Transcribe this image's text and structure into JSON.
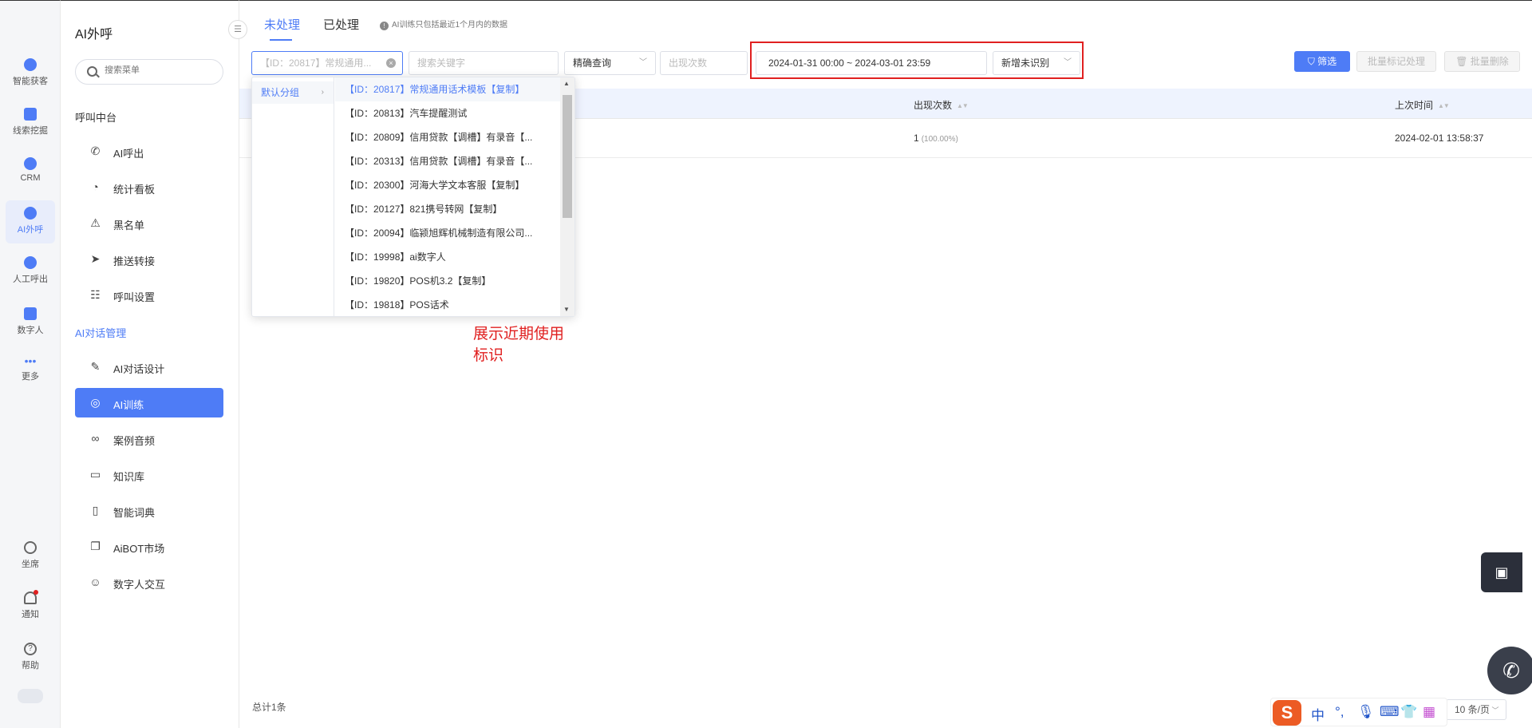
{
  "rail": {
    "items": [
      {
        "label": "智能获客",
        "icon": "smart-acquisition-icon"
      },
      {
        "label": "线索挖掘",
        "icon": "lead-mining-icon"
      },
      {
        "label": "CRM",
        "icon": "crm-icon"
      },
      {
        "label": "AI外呼",
        "icon": "ai-outbound-icon"
      },
      {
        "label": "人工呼出",
        "icon": "manual-call-icon"
      },
      {
        "label": "数字人",
        "icon": "digital-human-icon"
      },
      {
        "label": "更多",
        "icon": "more-icon"
      }
    ],
    "bottom": [
      {
        "label": "坐席",
        "icon": "headset-icon"
      },
      {
        "label": "通知",
        "icon": "bell-icon"
      },
      {
        "label": "帮助",
        "icon": "help-icon"
      }
    ]
  },
  "menu": {
    "title": "AI外呼",
    "search_placeholder": "搜索菜单",
    "group1": "呼叫中台",
    "group1_items": [
      "AI呼出",
      "统计看板",
      "黑名单",
      "推送转接",
      "呼叫设置"
    ],
    "group2": "AI对话管理",
    "group2_items": [
      "AI对话设计",
      "AI训练",
      "案例音频",
      "知识库",
      "智能词典",
      "AiBOT市场",
      "数字人交互"
    ]
  },
  "tabs": {
    "unprocessed": "未处理",
    "processed": "已处理",
    "notice": "AI训练只包括最近1个月内的数据"
  },
  "filters": {
    "script_select_value": "【ID：20817】常规通用...",
    "keyword_placeholder": "搜索关键字",
    "match_mode": "精确查询",
    "count_placeholder": "出现次数",
    "date_range": "2024-01-31 00:00 ~ 2024-03-01 23:59",
    "type_select": "新增未识别",
    "filter_button": "筛选",
    "batch_mark_button": "批量标记处理",
    "batch_delete_button": "批量删除"
  },
  "table": {
    "headers": [
      "出现次数",
      "上次时间"
    ],
    "rows": [
      {
        "count": "1",
        "percent": "(100.00%)",
        "last_time": "2024-02-01 13:58:37"
      }
    ],
    "total": "总计1条",
    "page_size": "10 条/页"
  },
  "cascader": {
    "group": "默认分组",
    "options": [
      "【ID：20817】常规通用话术模板【复制】",
      "【ID：20813】汽车提醒测试",
      "【ID：20809】信用贷款【调槽】有录音【...",
      "【ID：20313】信用贷款【调槽】有录音【...",
      "【ID：20300】河海大学文本客服【复制】",
      "【ID：20127】821携号转网【复制】",
      "【ID：20094】临颍旭辉机械制造有限公司...",
      "【ID：19998】ai数字人",
      "【ID：19820】POS机3.2【复制】",
      "【ID：19818】POS话术"
    ],
    "annotation": "展示近期使用标识"
  },
  "ime": {
    "logo": "S",
    "lang": "中"
  },
  "colors": {
    "accent": "#4e7cf6",
    "annotation_red": "#e02020"
  }
}
